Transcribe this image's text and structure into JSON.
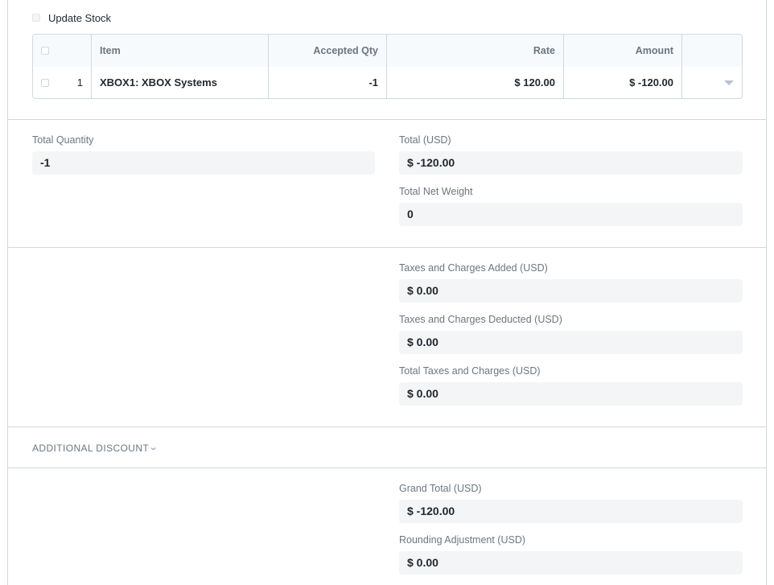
{
  "update_stock": {
    "label": "Update Stock",
    "checked": false
  },
  "items_table": {
    "columns": [
      "Item",
      "Accepted Qty",
      "Rate",
      "Amount"
    ],
    "rows": [
      {
        "index": "1",
        "item": "XBOX1: XBOX Systems",
        "accepted_qty": "-1",
        "rate": "$ 120.00",
        "amount": "$ -120.00"
      }
    ]
  },
  "totals": {
    "total_quantity": {
      "label": "Total Quantity",
      "value": "-1"
    },
    "total_usd": {
      "label": "Total (USD)",
      "value": "$ -120.00"
    },
    "total_net_weight": {
      "label": "Total Net Weight",
      "value": "0"
    }
  },
  "taxes": {
    "added": {
      "label": "Taxes and Charges Added (USD)",
      "value": "$ 0.00"
    },
    "deducted": {
      "label": "Taxes and Charges Deducted (USD)",
      "value": "$ 0.00"
    },
    "total": {
      "label": "Total Taxes and Charges (USD)",
      "value": "$ 0.00"
    }
  },
  "additional_discount": {
    "title": "ADDITIONAL DISCOUNT",
    "icon": "chevron-down-icon"
  },
  "grand": {
    "grand_total": {
      "label": "Grand Total (USD)",
      "value": "$ -120.00"
    },
    "rounding_adjustment": {
      "label": "Rounding Adjustment (USD)",
      "value": "$ 0.00"
    }
  }
}
